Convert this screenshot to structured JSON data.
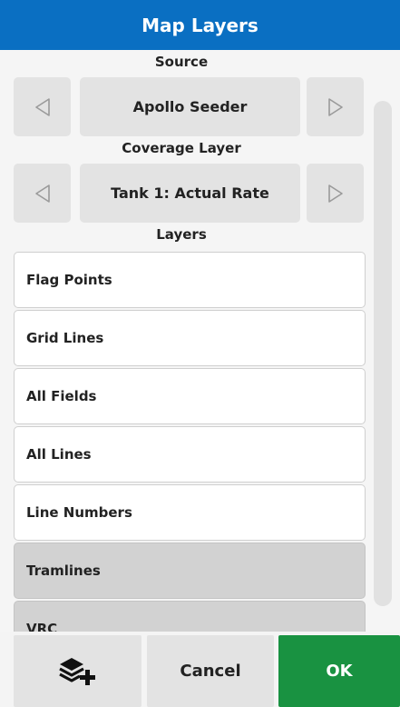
{
  "dialog": {
    "title": "Map Layers"
  },
  "source": {
    "label": "Source",
    "value": "Apollo Seeder",
    "prev_icon": "triangle-left-icon",
    "next_icon": "triangle-right-icon"
  },
  "coverage": {
    "label": "Coverage Layer",
    "value": "Tank 1: Actual Rate",
    "prev_icon": "triangle-left-icon",
    "next_icon": "triangle-right-icon"
  },
  "layers": {
    "label": "Layers",
    "items": [
      {
        "label": "Flag Points",
        "enabled": true
      },
      {
        "label": "Grid Lines",
        "enabled": true
      },
      {
        "label": "All Fields",
        "enabled": true
      },
      {
        "label": "All Lines",
        "enabled": true
      },
      {
        "label": "Line Numbers",
        "enabled": true
      },
      {
        "label": "Tramlines",
        "enabled": false
      },
      {
        "label": "VRC",
        "enabled": false
      }
    ]
  },
  "footer": {
    "add_layer_icon": "add-layer-icon",
    "cancel_label": "Cancel",
    "ok_label": "OK"
  },
  "colors": {
    "title_bar": "#0a6fc2",
    "ok_button": "#199241",
    "button_gray": "#e3e3e3",
    "layer_off": "#d2d2d2"
  }
}
